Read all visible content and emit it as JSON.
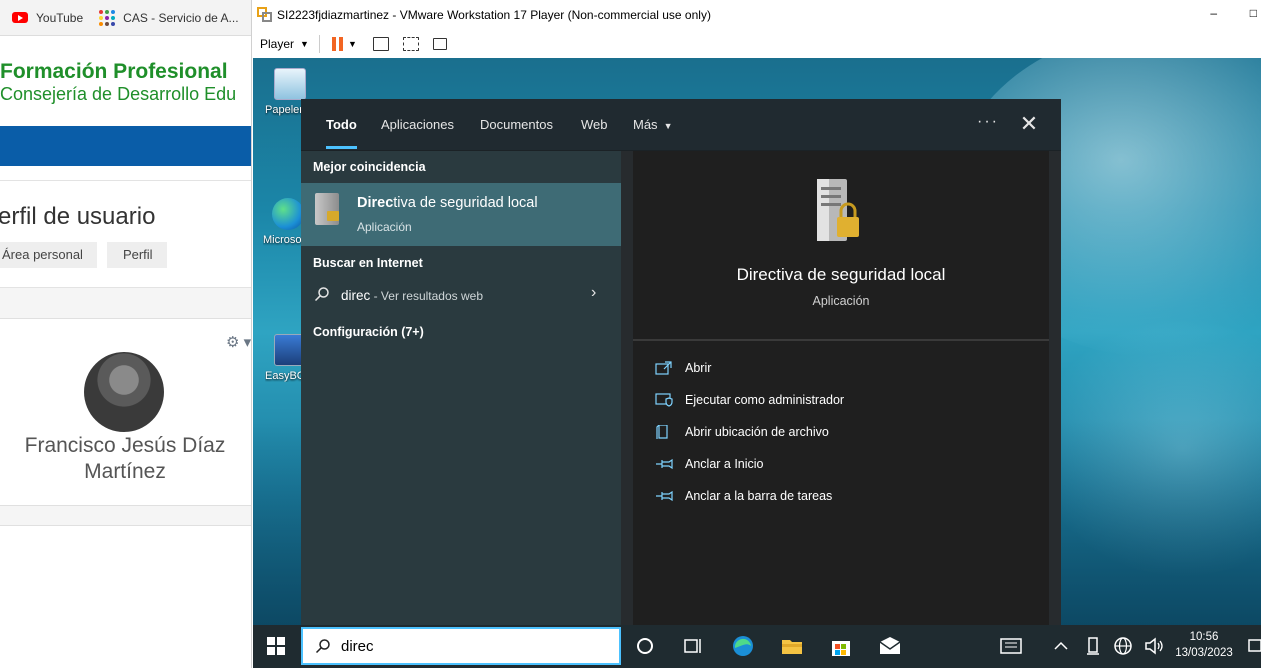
{
  "bookmarks": [
    {
      "label": "YouTube",
      "icon": "youtube-icon"
    },
    {
      "label": "CAS - Servicio de A...",
      "icon": "cas-icon"
    }
  ],
  "site": {
    "title": "Formación Profesional",
    "subtitle": "Consejería de Desarrollo Edu"
  },
  "profile": {
    "heading": "erfil de usuario",
    "breadcrumbs": [
      "Área personal",
      "Perfil"
    ],
    "user_name": "Francisco Jesús Díaz Martínez"
  },
  "vmware": {
    "title": "SI2223fjdiazmartinez - VMware Workstation 17 Player (Non-commercial use only)",
    "menu_player": "Player",
    "minimize": "–",
    "maximize": "□"
  },
  "desktop_icons": [
    {
      "label": "Papelera de reciclaje",
      "icon": "recycle-bin-icon"
    },
    {
      "label": "Microsoft Edge",
      "icon": "edge-icon"
    },
    {
      "label": "EasyBCD",
      "icon": "easybcd-icon"
    }
  ],
  "search": {
    "tabs": [
      "Todo",
      "Aplicaciones",
      "Documentos",
      "Web",
      "Más"
    ],
    "more_label": "···",
    "close_label": "✕",
    "best_match_header": "Mejor coincidencia",
    "best_match_bold": "Direc",
    "best_match_rest": "tiva de seguridad local",
    "best_match_type": "Aplicación",
    "internet_header": "Buscar en Internet",
    "web_query": "direc",
    "web_suffix": " - Ver resultados web",
    "settings_header": "Configuración (7+)",
    "preview_title": "Directiva de seguridad local",
    "preview_type": "Aplicación",
    "actions": [
      {
        "label": "Abrir",
        "icon": "open-icon"
      },
      {
        "label": "Ejecutar como administrador",
        "icon": "shield-admin-icon"
      },
      {
        "label": "Abrir ubicación de archivo",
        "icon": "file-location-icon"
      },
      {
        "label": "Anclar a Inicio",
        "icon": "pin-icon"
      },
      {
        "label": "Anclar a la barra de tareas",
        "icon": "pin-taskbar-icon"
      }
    ]
  },
  "taskbar": {
    "search_value": "direc",
    "time": "10:56",
    "date": "13/03/2023"
  },
  "colors": {
    "accent": "#4cc2ff",
    "best_match_bg": "#3e6b75",
    "fp_green": "#1f8f2a",
    "edu_blue": "#0a5da8"
  }
}
